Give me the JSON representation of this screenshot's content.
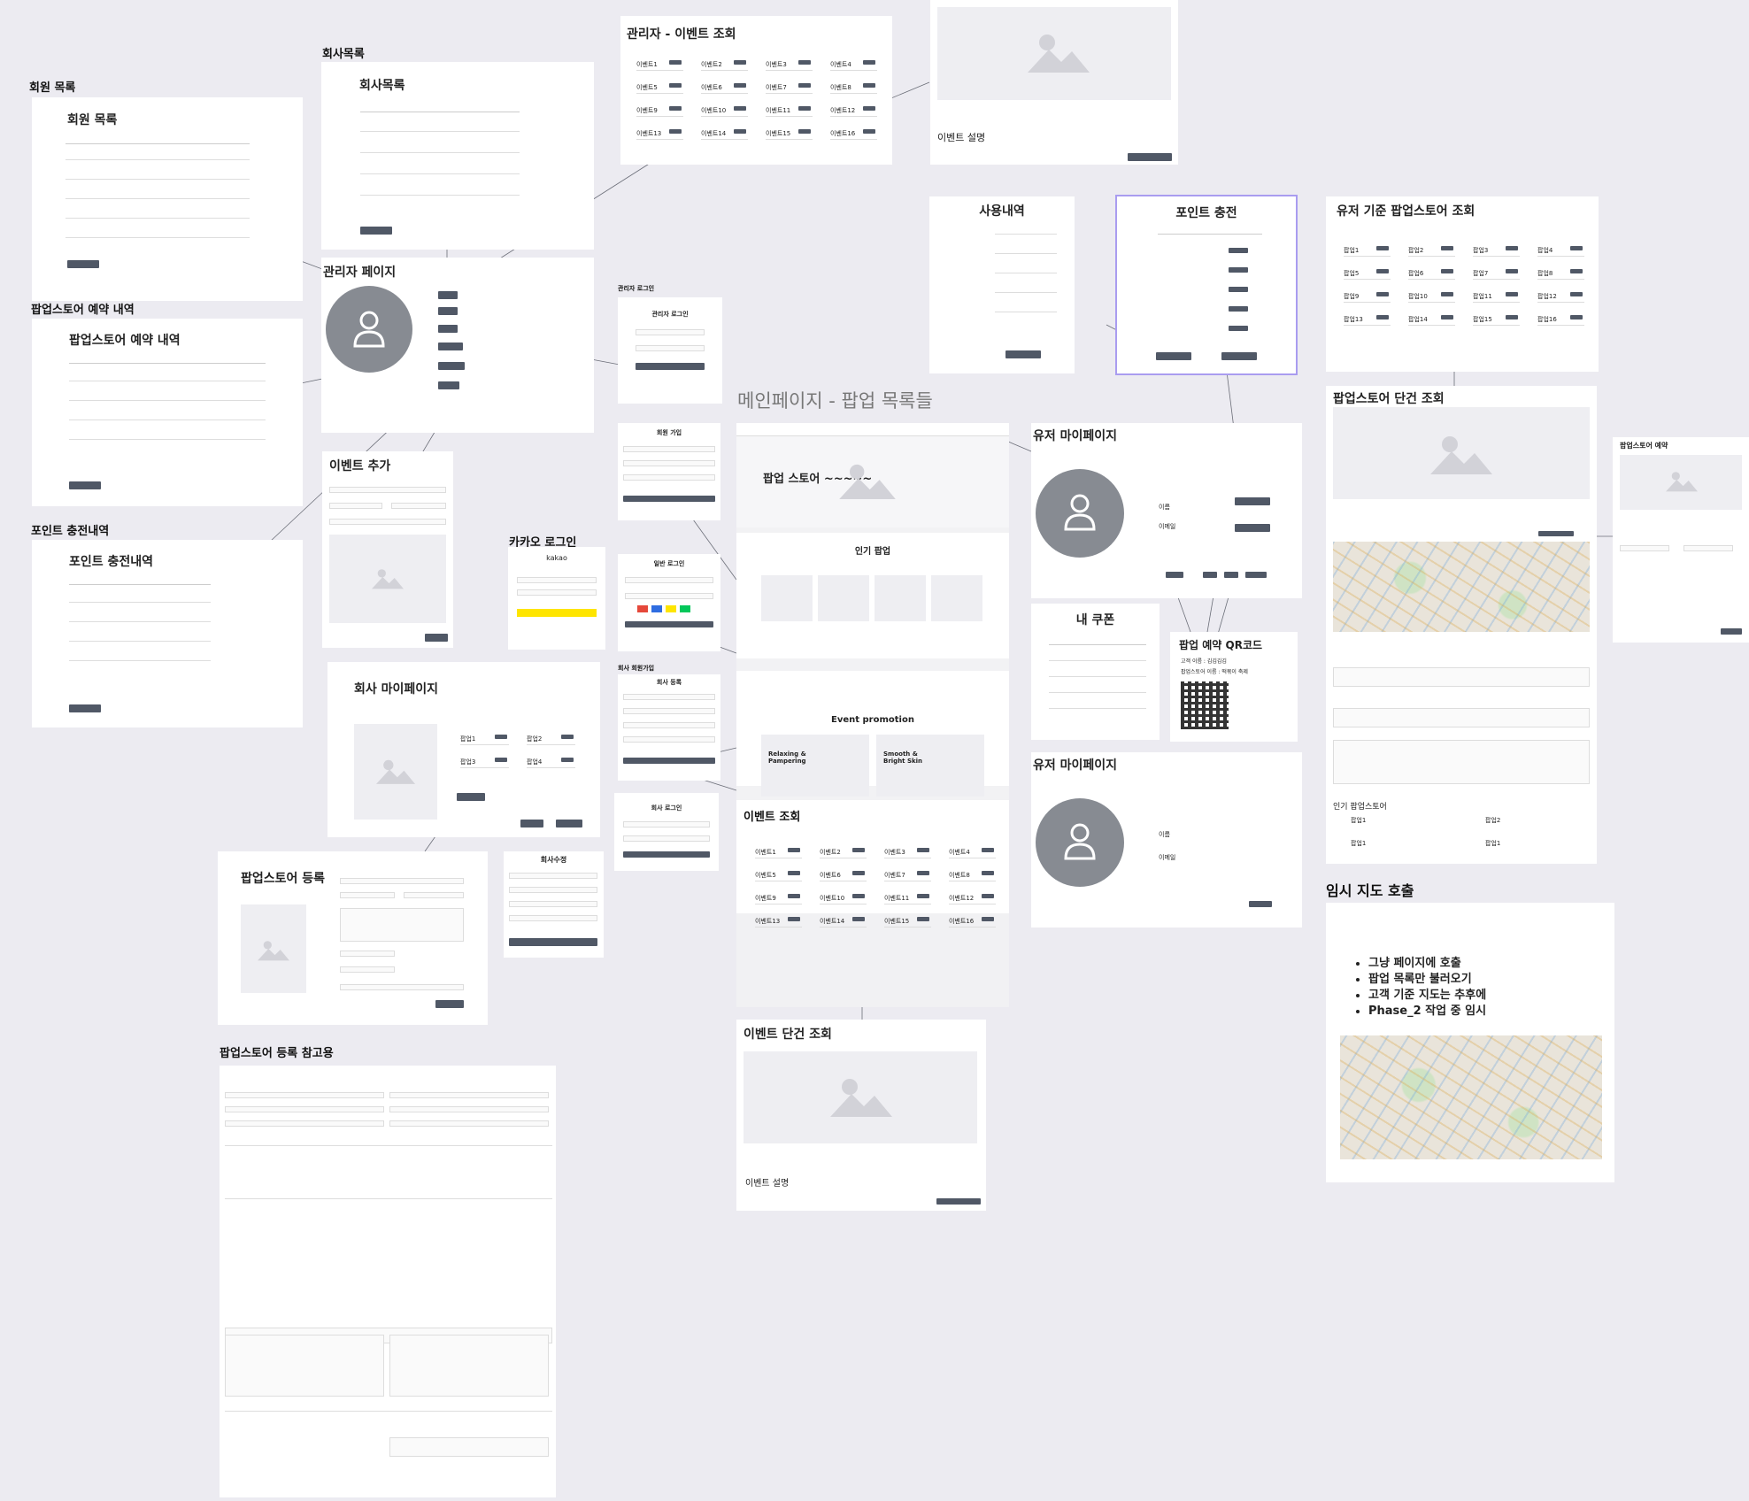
{
  "labels": {
    "member_list": "회원 목록",
    "company_list": "회사목록",
    "popup_reservation": "팝업스토어 예약 내역",
    "point_history": "포인트 충전내역",
    "admin_login": "관리자 로그인",
    "kakao_login": "카카오 로그인",
    "company_signup": "회사 회원가입",
    "popup_register_ref": "팝업스토어 등록 참고용",
    "main_page": "메인페이지 - 팝업 목록들",
    "temp_map": "임시 지도 호출"
  },
  "frames": {
    "member_list": "회원 목록",
    "company_list": "회사목록",
    "popup_reservation": "팝업스토어 예약 내역",
    "point_history": "포인트 충전내역",
    "admin_page": "관리자 페이지",
    "admin_event": "관리자 - 이벤트 조회",
    "event_add": "이벤트 추가",
    "company_mypage": "회사 마이페이지",
    "popup_register": "팝업스토어 등록",
    "company_edit": "회사수정",
    "admin_login_card": "관리자 로그인",
    "signup": "회원 가입",
    "integrated_login": "일반 로그인",
    "company_register": "회사 등록",
    "company_login": "회사 로그인",
    "usage": "사용내역",
    "point_charge": "포인트 충전",
    "user_popup_list": "유저 기준 팝업스토어 조회",
    "popup_detail": "팝업스토어 단건 조회",
    "popup_reserve": "팝업스토어 예약",
    "user_mypage_1": "유저 마이페이지",
    "user_mypage_2": "유저 마이페이지",
    "my_coupon": "내 쿠폰",
    "qr": "팝업 예약 QR코드",
    "event_list": "이벤트 조회",
    "event_detail": "이벤트 단건 조회"
  },
  "main": {
    "hero_title": "팝업 스토어 ~~~~~",
    "popular": "인기 팝업",
    "event_promotion": "Event promotion",
    "promo1": "Relaxing & Pampering",
    "promo2": "Smooth & Bright Skin"
  },
  "event_detail": {
    "desc": "이벤트 설명"
  },
  "event_view": {
    "desc": "이벤트 설명"
  },
  "kakao": {
    "logo": "kakao"
  },
  "mypage": {
    "name": "이름",
    "email": "이메일"
  },
  "qr": {
    "customer": "고객 이름 : 김김김김",
    "store": "팝업스토어 이름 : 떡볶이 축제"
  },
  "detail": {
    "popular_stores": "인기 팝업스토어",
    "store1": "팝업1",
    "store2": "팝업2",
    "store3": "팝업1",
    "store4": "팝업1"
  },
  "map_notes": [
    "그냥 페이지에 호출",
    "팝업 목록만 불러오기",
    "고객 기준 지도는 추후에",
    "Phase_2 작업 중 임시"
  ],
  "events_admin": [
    "이벤트1",
    "이벤트2",
    "이벤트3",
    "이벤트4",
    "이벤트5",
    "이벤트6",
    "이벤트7",
    "이벤트8",
    "이벤트9",
    "이벤트10",
    "이벤트11",
    "이벤트12",
    "이벤트13",
    "이벤트14",
    "이벤트15",
    "이벤트16"
  ],
  "popups_user": [
    "팝업1",
    "팝업2",
    "팝업3",
    "팝업4",
    "팝업5",
    "팝업6",
    "팝업7",
    "팝업8",
    "팝업9",
    "팝업10",
    "팝업11",
    "팝업12",
    "팝업13",
    "팝업14",
    "팝업15",
    "팝업16"
  ],
  "company_popups": [
    "팝업1",
    "팝업2",
    "팝업3",
    "팝업4"
  ],
  "colors": {
    "accent": "#505866",
    "select": "#a99cf0",
    "kakao": "#fee500"
  }
}
